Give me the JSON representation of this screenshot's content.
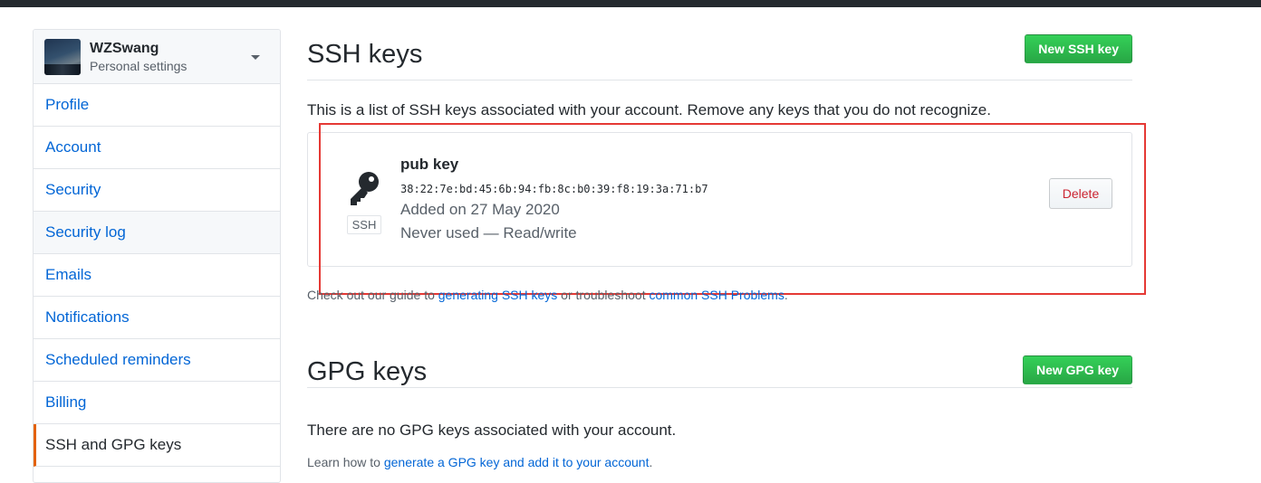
{
  "sidebar": {
    "user_name": "WZSwang",
    "user_sub": "Personal settings",
    "items": [
      {
        "label": "Profile"
      },
      {
        "label": "Account"
      },
      {
        "label": "Security"
      },
      {
        "label": "Security log"
      },
      {
        "label": "Emails"
      },
      {
        "label": "Notifications"
      },
      {
        "label": "Scheduled reminders"
      },
      {
        "label": "Billing"
      },
      {
        "label": "SSH and GPG keys"
      }
    ]
  },
  "ssh": {
    "title": "SSH keys",
    "new_button": "New SSH key",
    "description": "This is a list of SSH keys associated with your account. Remove any keys that you do not recognize.",
    "key": {
      "badge": "SSH",
      "name": "pub key",
      "fingerprint": "38:22:7e:bd:45:6b:94:fb:8c:b0:39:f8:19:3a:71:b7",
      "added": "Added on 27 May 2020",
      "usage": "Never used — Read/write",
      "delete_label": "Delete"
    },
    "guide_prefix": "Check out our guide to ",
    "guide_link1": "generating SSH keys",
    "guide_middle": " or troubleshoot ",
    "guide_link2": "common SSH Problems",
    "guide_suffix": "."
  },
  "gpg": {
    "title": "GPG keys",
    "new_button": "New GPG key",
    "none_text": "There are no GPG keys associated with your account.",
    "learn_prefix": "Learn how to ",
    "learn_link": "generate a GPG key and add it to your account",
    "learn_suffix": "."
  },
  "colors": {
    "accent_link": "#0366d6",
    "primary_button": "#28a745",
    "danger": "#cb2431",
    "selected_marker": "#e36209",
    "highlight_box": "#e53935"
  }
}
